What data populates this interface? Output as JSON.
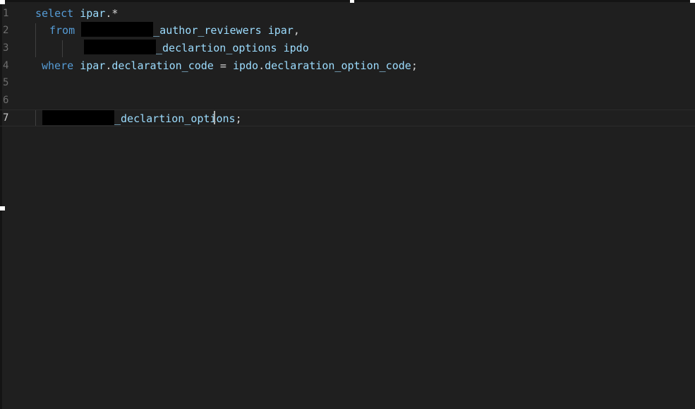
{
  "editor": {
    "lines": [
      {
        "number": "1",
        "tokens": [
          {
            "t": "select",
            "c": "kw"
          },
          {
            "t": " ",
            "c": "pn"
          },
          {
            "t": "ipar",
            "c": "id"
          },
          {
            "t": ".*",
            "c": "pn"
          }
        ]
      },
      {
        "number": "2",
        "tokens": [
          {
            "t": "from",
            "c": "kw"
          },
          {
            "t": " ",
            "c": "pn"
          },
          {
            "redacted": true
          },
          {
            "t": "_author_reviewers",
            "c": "id"
          },
          {
            "t": " ",
            "c": "pn"
          },
          {
            "t": "ipar",
            "c": "id"
          },
          {
            "t": ",",
            "c": "pn"
          }
        ]
      },
      {
        "number": "3",
        "tokens": [
          {
            "redacted": true
          },
          {
            "t": "_declartion_options",
            "c": "id"
          },
          {
            "t": " ",
            "c": "pn"
          },
          {
            "t": "ipdo",
            "c": "id"
          }
        ]
      },
      {
        "number": "4",
        "tokens": [
          {
            "t": "where",
            "c": "kw"
          },
          {
            "t": " ",
            "c": "pn"
          },
          {
            "t": "ipar",
            "c": "id"
          },
          {
            "t": ".",
            "c": "pn"
          },
          {
            "t": "declaration_code",
            "c": "id"
          },
          {
            "t": " = ",
            "c": "pn"
          },
          {
            "t": "ipdo",
            "c": "id"
          },
          {
            "t": ".",
            "c": "pn"
          },
          {
            "t": "declaration_option_code",
            "c": "id"
          },
          {
            "t": ";",
            "c": "pn"
          }
        ]
      },
      {
        "number": "5",
        "tokens": []
      },
      {
        "number": "6",
        "tokens": []
      },
      {
        "number": "7",
        "current": true,
        "tokens": [
          {
            "redacted": true
          },
          {
            "t": "_declartion_options",
            "c": "id"
          },
          {
            "t": ";",
            "c": "pn"
          }
        ]
      }
    ]
  },
  "colors": {
    "background": "#1f1f1f",
    "keyword": "#569cd6",
    "identifier": "#9cdcfe",
    "punctuation": "#d4d4d4",
    "line_number": "#6e6e6e",
    "redaction": "#000000"
  }
}
